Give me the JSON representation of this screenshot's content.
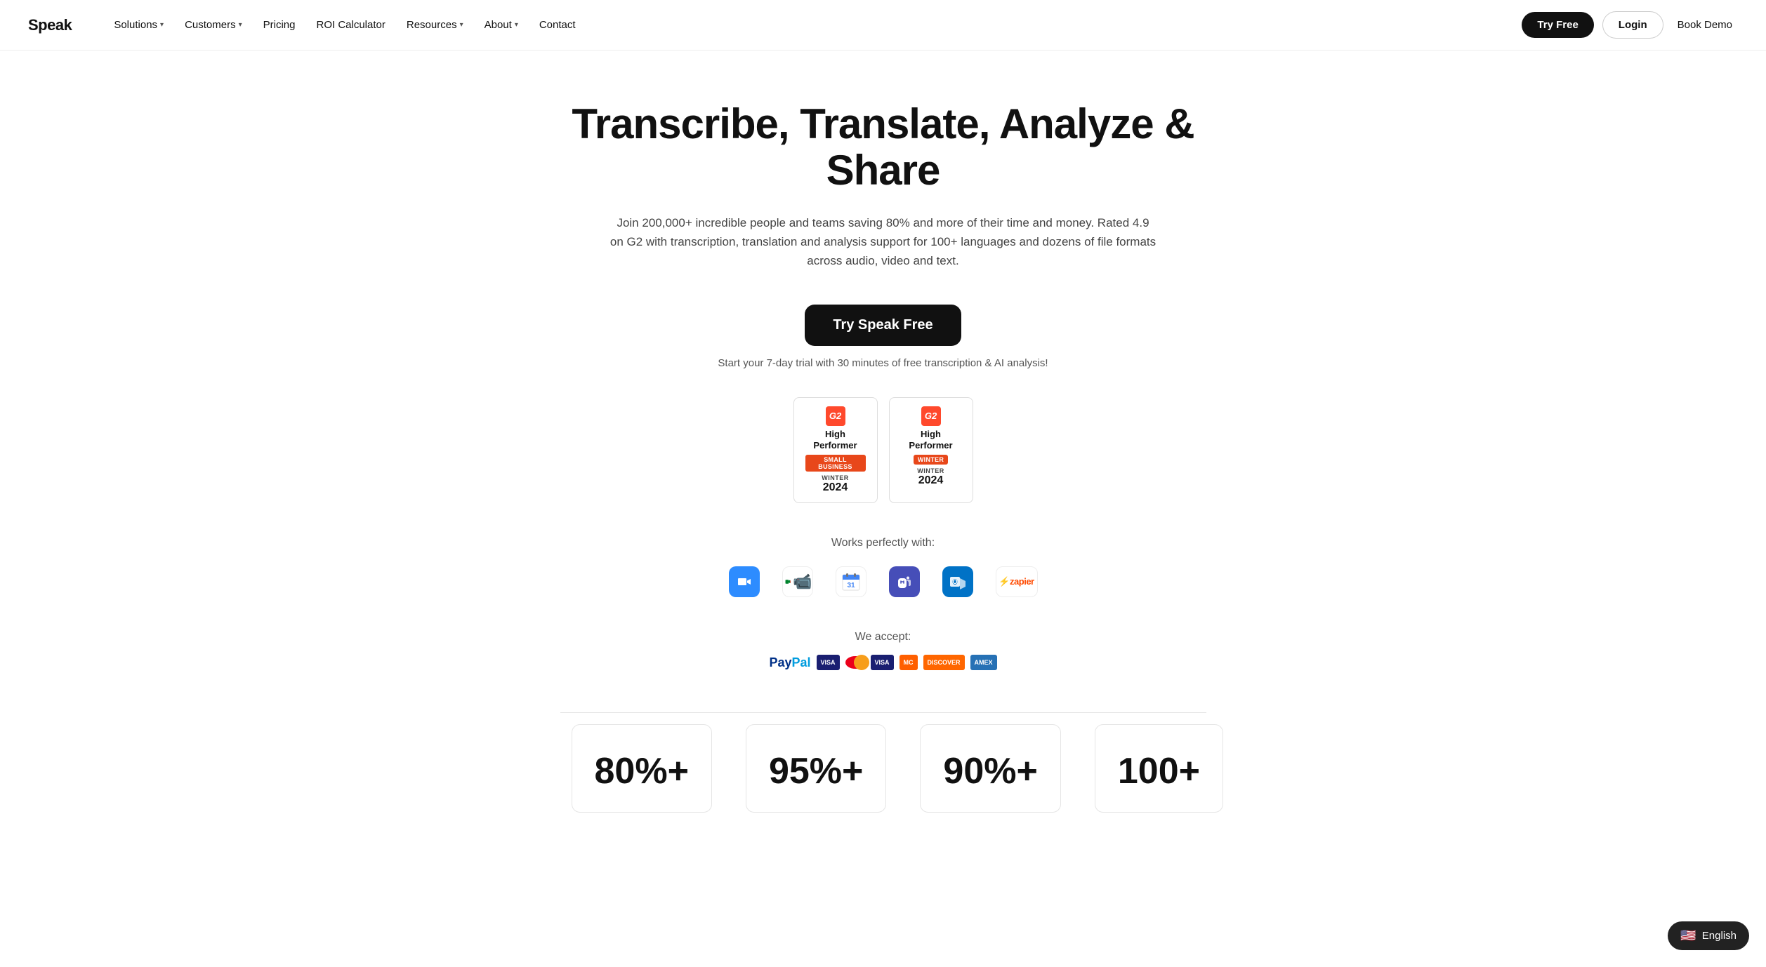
{
  "brand": {
    "name": "Speak"
  },
  "nav": {
    "links": [
      {
        "label": "Solutions",
        "has_dropdown": true
      },
      {
        "label": "Customers",
        "has_dropdown": true
      },
      {
        "label": "Pricing",
        "has_dropdown": false
      },
      {
        "label": "ROI Calculator",
        "has_dropdown": false
      },
      {
        "label": "Resources",
        "has_dropdown": true
      },
      {
        "label": "About",
        "has_dropdown": true
      },
      {
        "label": "Contact",
        "has_dropdown": false
      }
    ],
    "try_free_label": "Try Free",
    "login_label": "Login",
    "book_demo_label": "Book Demo"
  },
  "hero": {
    "title": "Transcribe, Translate, Analyze & Share",
    "subtitle": "Join 200,000+ incredible people and teams saving 80% and more of their time and money. Rated 4.9 on G2 with transcription, translation and analysis support for 100+ languages and dozens of file formats across audio, video and text.",
    "cta_button": "Try Speak Free",
    "trial_note": "Start your 7-day trial with 30 minutes of free transcription & AI analysis!"
  },
  "badges": [
    {
      "g2_label": "G2",
      "title": "High Performer",
      "category": "Small Business",
      "category_color": "#E8471A",
      "season": "WINTER",
      "year": "2024"
    },
    {
      "g2_label": "G2",
      "title": "High Performer",
      "category": "WINTER",
      "category_color": "#E8471A",
      "season": "WINTER",
      "year": "2024"
    }
  ],
  "integrations": {
    "label": "Works perfectly with:",
    "items": [
      {
        "name": "Zoom",
        "type": "zoom"
      },
      {
        "name": "Google Meet",
        "type": "meet"
      },
      {
        "name": "Google Calendar",
        "type": "gcal"
      },
      {
        "name": "Microsoft Teams",
        "type": "teams"
      },
      {
        "name": "Microsoft Outlook",
        "type": "outlook"
      },
      {
        "name": "Zapier",
        "type": "zapier"
      }
    ]
  },
  "payment": {
    "label": "We accept:",
    "methods": [
      "PayPal",
      "Visa",
      "Mastercard",
      "Visa",
      "Mastercard",
      "Discover",
      "Amex"
    ]
  },
  "stats": [
    {
      "number": "80%+",
      "label": ""
    },
    {
      "number": "95%+",
      "label": ""
    },
    {
      "number": "90%+",
      "label": ""
    },
    {
      "number": "100+",
      "label": ""
    }
  ],
  "language_pill": {
    "flag": "🇺🇸",
    "label": "English"
  }
}
